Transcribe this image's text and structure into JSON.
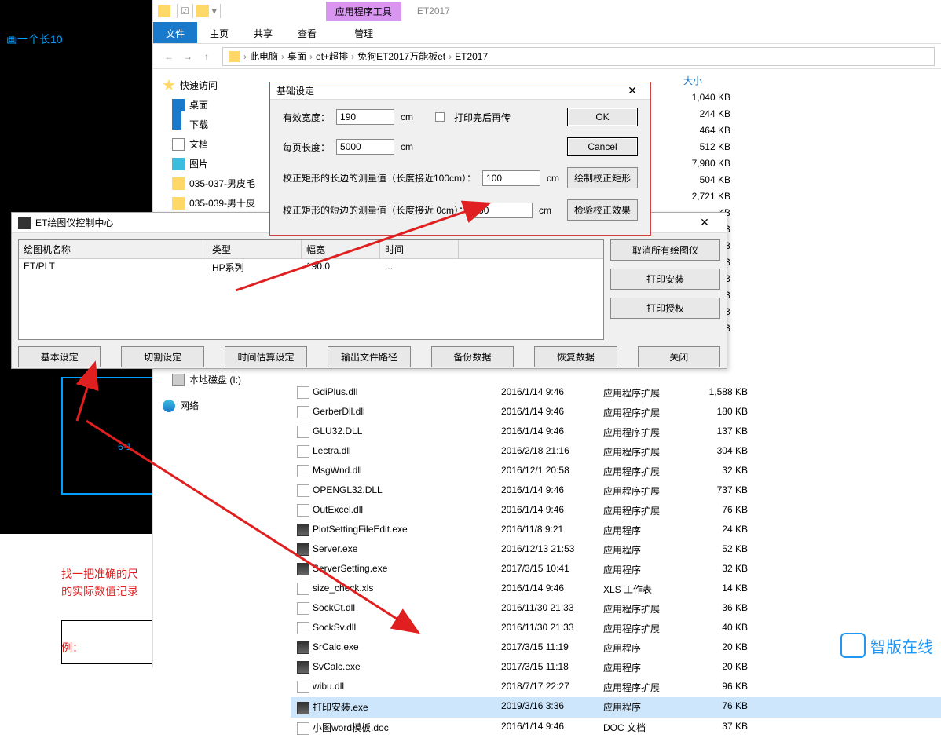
{
  "cad": {
    "hint": "画一个长10",
    "dim": "6-1",
    "note1": "找一把准确的尺",
    "note2": "的实际数值记录",
    "note3": "例："
  },
  "explorer": {
    "toolTab": "应用程序工具",
    "title": "ET2017",
    "tabs": {
      "file": "文件",
      "home": "主页",
      "share": "共享",
      "view": "查看",
      "manage": "管理"
    },
    "breadcrumb": [
      "此电脑",
      "桌面",
      "et+超排",
      "免狗ET2017万能板et",
      "ET2017"
    ],
    "sizeHeader": "大小",
    "sidebar": {
      "quick": "快速访问",
      "desktop": "桌面",
      "downloads": "下载",
      "documents": "文档",
      "pictures": "图片",
      "f1": "035-037-男皮毛",
      "f2": "035-039-男十皮",
      "disk": "本地磁盘 (I:)",
      "network": "网络"
    },
    "topSizes": [
      "1,040 KB",
      "244 KB",
      "464 KB",
      "512 KB",
      "7,980 KB",
      "504 KB",
      "2,721 KB",
      "KB",
      "KB",
      "KB",
      "KB",
      "KB",
      "KB",
      "KB",
      "KB"
    ],
    "files": [
      {
        "name": "GdiPlus.dll",
        "date": "2016/1/14 9:46",
        "type": "应用程序扩展",
        "size": "1,588 KB"
      },
      {
        "name": "GerberDll.dll",
        "date": "2016/1/14 9:46",
        "type": "应用程序扩展",
        "size": "180 KB"
      },
      {
        "name": "GLU32.DLL",
        "date": "2016/1/14 9:46",
        "type": "应用程序扩展",
        "size": "137 KB"
      },
      {
        "name": "Lectra.dll",
        "date": "2016/2/18 21:16",
        "type": "应用程序扩展",
        "size": "304 KB"
      },
      {
        "name": "MsgWnd.dll",
        "date": "2016/12/1 20:58",
        "type": "应用程序扩展",
        "size": "32 KB"
      },
      {
        "name": "OPENGL32.DLL",
        "date": "2016/1/14 9:46",
        "type": "应用程序扩展",
        "size": "737 KB"
      },
      {
        "name": "OutExcel.dll",
        "date": "2016/1/14 9:46",
        "type": "应用程序扩展",
        "size": "76 KB"
      },
      {
        "name": "PlotSettingFileEdit.exe",
        "date": "2016/11/8 9:21",
        "type": "应用程序",
        "size": "24 KB",
        "exe": true
      },
      {
        "name": "Server.exe",
        "date": "2016/12/13 21:53",
        "type": "应用程序",
        "size": "52 KB",
        "exe": true
      },
      {
        "name": "ServerSetting.exe",
        "date": "2017/3/15 10:41",
        "type": "应用程序",
        "size": "32 KB",
        "exe": true
      },
      {
        "name": "size_check.xls",
        "date": "2016/1/14 9:46",
        "type": "XLS 工作表",
        "size": "14 KB"
      },
      {
        "name": "SockCt.dll",
        "date": "2016/11/30 21:33",
        "type": "应用程序扩展",
        "size": "36 KB"
      },
      {
        "name": "SockSv.dll",
        "date": "2016/11/30 21:33",
        "type": "应用程序扩展",
        "size": "40 KB"
      },
      {
        "name": "SrCalc.exe",
        "date": "2017/3/15 11:19",
        "type": "应用程序",
        "size": "20 KB",
        "exe": true
      },
      {
        "name": "SvCalc.exe",
        "date": "2017/3/15 11:18",
        "type": "应用程序",
        "size": "20 KB",
        "exe": true
      },
      {
        "name": "wibu.dll",
        "date": "2018/7/17 22:27",
        "type": "应用程序扩展",
        "size": "96 KB"
      },
      {
        "name": "打印安装.exe",
        "date": "2019/3/16 3:36",
        "type": "应用程序",
        "size": "76 KB",
        "exe": true,
        "sel": true
      },
      {
        "name": "小图word模板.doc",
        "date": "2016/1/14 9:46",
        "type": "DOC 文档",
        "size": "37 KB"
      }
    ]
  },
  "plotter": {
    "title": "ET绘图仪控制中心",
    "cols": {
      "c1": "绘图机名称",
      "c2": "类型",
      "c3": "幅宽",
      "c4": "时间"
    },
    "row": {
      "c1": "ET/PLT",
      "c2": "HP系列",
      "c3": "190.0",
      "c4": "..."
    },
    "btns": {
      "cancelAll": "取消所有绘图仪",
      "install": "打印安装",
      "auth": "打印授权"
    },
    "bottom": {
      "basic": "基本设定",
      "cut": "切割设定",
      "time": "时间估算设定",
      "output": "输出文件路径",
      "backup": "备份数据",
      "restore": "恢复数据",
      "close": "关闭"
    }
  },
  "settings": {
    "title": "基础设定",
    "width_lbl": "有效宽度：",
    "width_val": "190",
    "cm": "cm",
    "len_lbl": "每页长度：",
    "len_val": "5000",
    "print_after": "打印完后再传",
    "ok": "OK",
    "cancel": "Cancel",
    "long_lbl": "校正矩形的长边的测量值（长度接近100cm）：",
    "long_val": "100",
    "short_lbl": "校正矩形的短边的测量值（长度接近  0cm）：",
    "short_val": "60",
    "draw_btn": "绘制校正矩形",
    "check_btn": "检验校正效果"
  },
  "watermark": "智版在线"
}
